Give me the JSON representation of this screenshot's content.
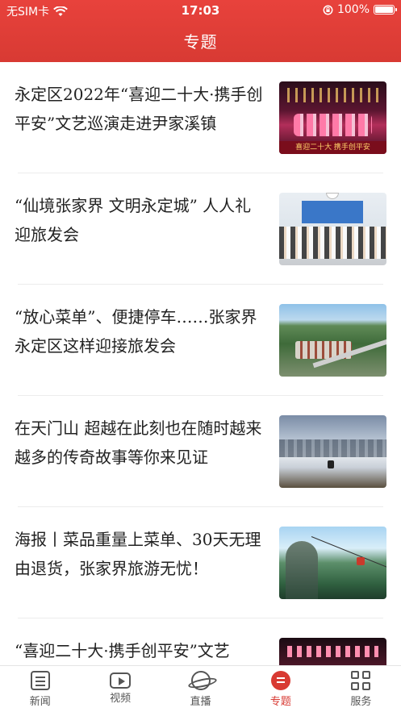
{
  "status_bar": {
    "carrier": "无SIM卡",
    "time": "17:03",
    "battery": "100%"
  },
  "header": {
    "title": "专题"
  },
  "feed": {
    "items": [
      {
        "title": "永定区2022年“喜迎二十大·携手创平安”文艺巡演走进尹家溪镇",
        "thumb_caption": "喜迎二十大 携手创平安",
        "thumb": "stage-performance"
      },
      {
        "title": "“仙境张家界 文明永定城” 人人礼迎旅发会",
        "thumb": "conference-hall"
      },
      {
        "title": "“放心菜单”、便捷停车……张家界永定区这样迎接旅发会",
        "thumb": "aerial-town"
      },
      {
        "title": "在天门山 超越在此刻也在随时越来越多的传奇故事等你来见证",
        "thumb": "misty-mountains"
      },
      {
        "title": "海报丨菜品重量上菜单、30天无理由退货，张家界旅游无忧！",
        "thumb": "cable-car"
      },
      {
        "title": "“喜迎二十大·携手创平安”文艺",
        "thumb": "stage-performance"
      }
    ]
  },
  "tabbar": {
    "tabs": [
      {
        "label": "新闻",
        "icon": "news-icon"
      },
      {
        "label": "视频",
        "icon": "video-icon"
      },
      {
        "label": "直播",
        "icon": "live-icon"
      },
      {
        "label": "专题",
        "icon": "topic-icon",
        "active": true
      },
      {
        "label": "服务",
        "icon": "service-icon"
      }
    ]
  },
  "colors": {
    "brand_red": "#d83a33",
    "text": "#222222",
    "tab_inactive": "#555555"
  }
}
